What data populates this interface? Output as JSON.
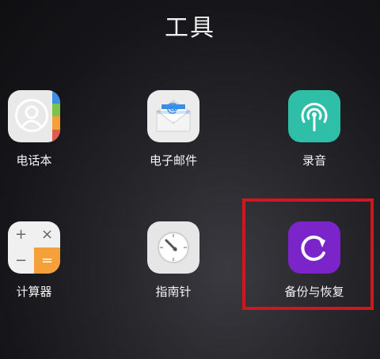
{
  "folder": {
    "title": "工具"
  },
  "apps": [
    {
      "label": "电话本",
      "icon": "contacts-icon"
    },
    {
      "label": "电子邮件",
      "icon": "mail-icon"
    },
    {
      "label": "录音",
      "icon": "recorder-icon"
    },
    {
      "label": "计算器",
      "icon": "calculator-icon"
    },
    {
      "label": "指南针",
      "icon": "compass-icon"
    },
    {
      "label": "备份与恢复",
      "icon": "backup-restore-icon"
    }
  ],
  "calculator_keys": [
    "+",
    "×",
    "−",
    "="
  ],
  "mail_symbol": "@",
  "colors": {
    "highlight": "#d0161e",
    "recorder": "#2fbfa8",
    "backup": "#7b24c9",
    "calc_accent": "#f6a03a",
    "contacts_tabs": [
      "#3a8ee6",
      "#7dc24a",
      "#f6a03a",
      "#e25a4a"
    ]
  }
}
